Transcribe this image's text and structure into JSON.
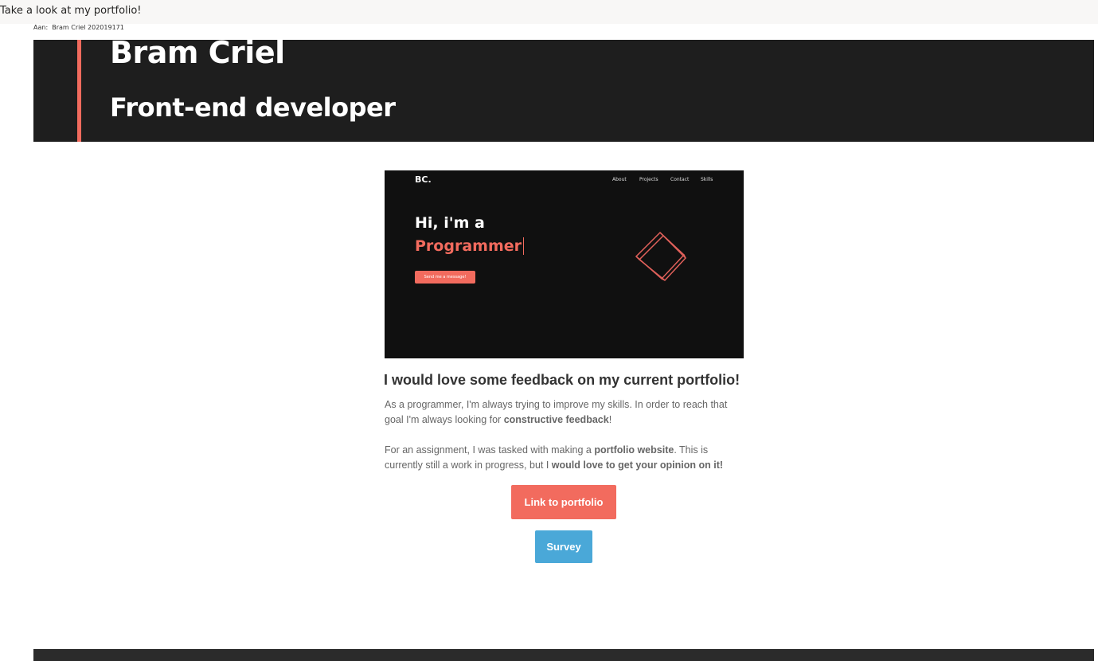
{
  "email": {
    "subject": "Take a look at my portfolio!",
    "to_label": "Aan:",
    "to_value": "Bram Criel 202019171"
  },
  "header": {
    "name": "Bram Criel",
    "role": "Front-end developer"
  },
  "preview": {
    "logo": "BC.",
    "nav": [
      "About",
      "Projects",
      "Contact",
      "Skills"
    ],
    "greeting": "Hi, i'm a",
    "role": "Programmer",
    "button": "Send me a message!"
  },
  "body": {
    "title": "I would love some feedback on my current portfolio!",
    "p1_a": "As a programmer, I'm always trying to improve my skills. In order to reach that goal I'm always looking for ",
    "p1_b": "constructive feedback",
    "p1_c": "!",
    "p2_a": "For an assignment, I was tasked with making a ",
    "p2_b": "portfolio website",
    "p2_c": ". This is currently still a work in progress, but I ",
    "p2_d": "would love to get your opinion on it!"
  },
  "buttons": {
    "portfolio": "Link to portfolio",
    "survey": "Survey"
  },
  "colors": {
    "accent": "#f26b5e",
    "survey": "#4aa8d8",
    "header_bg": "#1e1e1e"
  }
}
